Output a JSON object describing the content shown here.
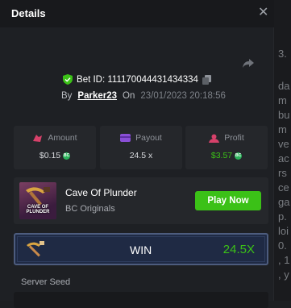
{
  "header": {
    "title": "Details"
  },
  "bet": {
    "id_label": "Bet ID: 111170044431434334",
    "by_label": "By",
    "username": "Parker23",
    "on_label": "On",
    "datetime": "23/01/2023 20:18:56"
  },
  "stats": {
    "amount": {
      "label": "Amount",
      "value": "$0.15",
      "coin": "BC"
    },
    "payout": {
      "label": "Payout",
      "value": "24.5 x"
    },
    "profit": {
      "label": "Profit",
      "value": "$3.57",
      "coin": "BC"
    }
  },
  "game": {
    "thumb_text": "CAVE OF PLUNDER",
    "title": "Cave Of Plunder",
    "provider": "BC Originals",
    "play_label": "Play Now"
  },
  "result": {
    "label": "WIN",
    "multiplier": "24.5X"
  },
  "seed": {
    "label": "Server Seed"
  },
  "background_text": [
    "3.",
    "da",
    "m",
    "bu",
    "m",
    "ve",
    "ac",
    "rs",
    "ce",
    "ga",
    "p.",
    "loi",
    "0.",
    ", 1",
    ", y"
  ],
  "colors": {
    "accent_green": "#3bc117",
    "panel": "#25272b",
    "modal_bg": "#1e2024"
  },
  "icons": [
    "close-icon",
    "share-icon",
    "shield-check-icon",
    "copy-icon",
    "coins-icon",
    "wallet-icon",
    "profit-icon",
    "pickaxe-icon"
  ]
}
